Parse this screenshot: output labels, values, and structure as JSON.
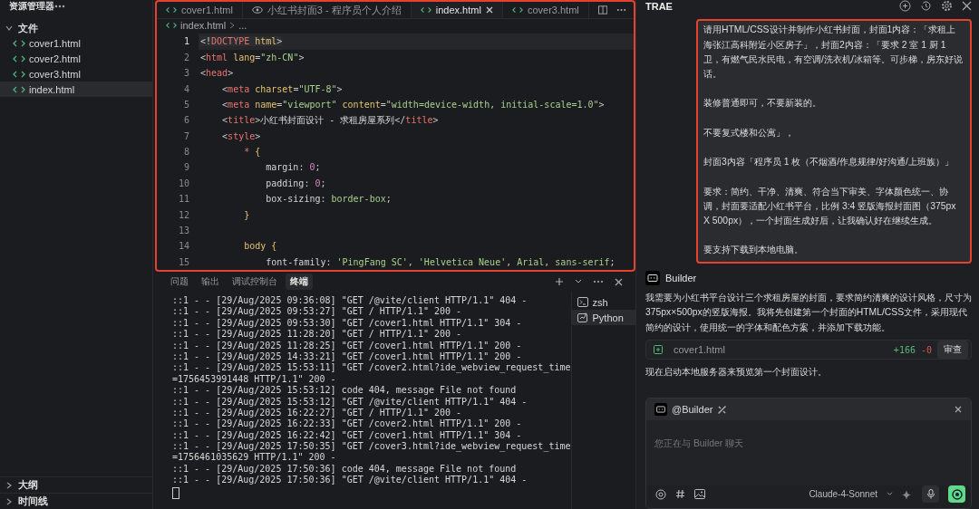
{
  "sidebar": {
    "title": "资源管理器",
    "folder": {
      "label": "文件",
      "expanded": true,
      "children": [
        {
          "label": "cover1.html",
          "selected": false
        },
        {
          "label": "cover2.html",
          "selected": false
        },
        {
          "label": "cover3.html",
          "selected": false
        },
        {
          "label": "index.html",
          "selected": true
        }
      ]
    },
    "sections": [
      {
        "label": "大纲",
        "expanded": false
      },
      {
        "label": "时间线",
        "expanded": false
      }
    ]
  },
  "editor": {
    "tabs": [
      {
        "label": "cover1.html",
        "kind": "code",
        "selected": false
      },
      {
        "label": "小红书封面3 - 程序员个人介绍",
        "kind": "preview",
        "selected": false
      },
      {
        "label": "index.html",
        "kind": "code",
        "selected": true
      },
      {
        "label": "cover3.html",
        "kind": "code",
        "selected": false
      }
    ],
    "breadcrumb": [
      "index.html",
      "..."
    ],
    "lines": [
      {
        "number": "1",
        "current": true,
        "tokens": [
          {
            "kind": "p",
            "text": "<!"
          },
          {
            "kind": "tag",
            "text": "DOCTYPE"
          },
          {
            "kind": "attr",
            "text": " html"
          },
          {
            "kind": "p",
            "text": ">"
          }
        ]
      },
      {
        "number": "2",
        "current": false,
        "tokens": [
          {
            "kind": "p",
            "text": "<"
          },
          {
            "kind": "tag",
            "text": "html"
          },
          {
            "kind": "attr",
            "text": " lang"
          },
          {
            "kind": "p",
            "text": "="
          },
          {
            "kind": "str",
            "text": "\"zh-CN\""
          },
          {
            "kind": "p",
            "text": ">"
          }
        ]
      },
      {
        "number": "3",
        "current": false,
        "tokens": [
          {
            "kind": "p",
            "text": "<"
          },
          {
            "kind": "tag",
            "text": "head"
          },
          {
            "kind": "p",
            "text": ">"
          }
        ]
      },
      {
        "number": "4",
        "current": false,
        "tokens": [
          {
            "kind": "p",
            "text": "    <"
          },
          {
            "kind": "tag",
            "text": "meta"
          },
          {
            "kind": "attr",
            "text": " charset"
          },
          {
            "kind": "p",
            "text": "="
          },
          {
            "kind": "str",
            "text": "\"UTF-8\""
          },
          {
            "kind": "p",
            "text": ">"
          }
        ]
      },
      {
        "number": "5",
        "current": false,
        "tokens": [
          {
            "kind": "p",
            "text": "    <"
          },
          {
            "kind": "tag",
            "text": "meta"
          },
          {
            "kind": "attr",
            "text": " name"
          },
          {
            "kind": "p",
            "text": "="
          },
          {
            "kind": "str",
            "text": "\"viewport\""
          },
          {
            "kind": "attr",
            "text": " content"
          },
          {
            "kind": "p",
            "text": "="
          },
          {
            "kind": "str",
            "text": "\"width=device-width, initial-scale=1.0\""
          },
          {
            "kind": "p",
            "text": ">"
          }
        ]
      },
      {
        "number": "6",
        "current": false,
        "tokens": [
          {
            "kind": "p",
            "text": "    <"
          },
          {
            "kind": "tag",
            "text": "title"
          },
          {
            "kind": "p",
            "text": ">"
          },
          {
            "kind": "txt",
            "text": "小红书封面设计 - 求租房屋系列"
          },
          {
            "kind": "p",
            "text": "</"
          },
          {
            "kind": "tag",
            "text": "title"
          },
          {
            "kind": "p",
            "text": ">"
          }
        ]
      },
      {
        "number": "7",
        "current": false,
        "tokens": [
          {
            "kind": "p",
            "text": "    <"
          },
          {
            "kind": "tag",
            "text": "style"
          },
          {
            "kind": "p",
            "text": ">"
          }
        ]
      },
      {
        "number": "8",
        "current": false,
        "tokens": [
          {
            "kind": "sel",
            "text": "        *"
          },
          {
            "kind": "brace",
            "text": " {"
          }
        ]
      },
      {
        "number": "9",
        "current": false,
        "tokens": [
          {
            "kind": "prop",
            "text": "            margin"
          },
          {
            "kind": "p",
            "text": ": "
          },
          {
            "kind": "num",
            "text": "0"
          },
          {
            "kind": "p",
            "text": ";"
          }
        ]
      },
      {
        "number": "10",
        "current": false,
        "tokens": [
          {
            "kind": "prop",
            "text": "            padding"
          },
          {
            "kind": "p",
            "text": ": "
          },
          {
            "kind": "num",
            "text": "0"
          },
          {
            "kind": "p",
            "text": ";"
          }
        ]
      },
      {
        "number": "11",
        "current": false,
        "tokens": [
          {
            "kind": "prop",
            "text": "            box-sizing"
          },
          {
            "kind": "p",
            "text": ": "
          },
          {
            "kind": "val",
            "text": "border-box"
          },
          {
            "kind": "p",
            "text": ";"
          }
        ]
      },
      {
        "number": "12",
        "current": false,
        "tokens": [
          {
            "kind": "brace",
            "text": "        }"
          }
        ]
      },
      {
        "number": "13",
        "current": false
      },
      {
        "number": "14",
        "current": false,
        "tokens": [
          {
            "kind": "brace",
            "text": "        body {"
          }
        ]
      },
      {
        "number": "15",
        "current": false,
        "tokens": [
          {
            "kind": "prop",
            "text": "            font-family"
          },
          {
            "kind": "p",
            "text": ": "
          },
          {
            "kind": "val",
            "text": "'PingFang SC', 'Helvetica Neue', Arial, sans-serif"
          },
          {
            "kind": "p",
            "text": ";"
          }
        ]
      }
    ]
  },
  "panel": {
    "tabs": [
      {
        "label": "问题",
        "selected": false
      },
      {
        "label": "输出",
        "selected": false
      },
      {
        "label": "调试控制台",
        "selected": false
      },
      {
        "label": "终端",
        "selected": true
      }
    ],
    "terminal": [
      "::1 - - [29/Aug/2025 09:36:08] \"GET /@vite/client HTTP/1.1\" 404 -",
      "::1 - - [29/Aug/2025 09:53:27] \"GET / HTTP/1.1\" 200 -",
      "::1 - - [29/Aug/2025 09:53:30] \"GET /cover1.html HTTP/1.1\" 304 -",
      "::1 - - [29/Aug/2025 11:28:20] \"GET / HTTP/1.1\" 200 -",
      "::1 - - [29/Aug/2025 11:28:25] \"GET /cover1.html HTTP/1.1\" 200 -",
      "::1 - - [29/Aug/2025 14:33:21] \"GET /cover1.html HTTP/1.1\" 200 -",
      "::1 - - [29/Aug/2025 15:53:11] \"GET /cover2.html?ide_webview_request_time",
      "=1756453991448 HTTP/1.1\" 200 -",
      "::1 - - [29/Aug/2025 15:53:12] code 404, message File not found",
      "::1 - - [29/Aug/2025 15:53:12] \"GET /@vite/client HTTP/1.1\" 404 -",
      "::1 - - [29/Aug/2025 16:22:27] \"GET / HTTP/1.1\" 200 -",
      "::1 - - [29/Aug/2025 16:22:33] \"GET /cover2.html HTTP/1.1\" 200 -",
      "::1 - - [29/Aug/2025 16:22:42] \"GET /cover1.html HTTP/1.1\" 304 -",
      "::1 - - [29/Aug/2025 17:50:35] \"GET /cover3.html?ide_webview_request_time",
      "=1756461035629 HTTP/1.1\" 200 -",
      "::1 - - [29/Aug/2025 17:50:36] code 404, message File not found",
      "::1 - - [29/Aug/2025 17:50:36] \"GET /@vite/client HTTP/1.1\" 404 -"
    ],
    "sessions": [
      {
        "label": "zsh",
        "kind": "shell",
        "selected": false
      },
      {
        "label": "Python",
        "kind": "python",
        "selected": true
      }
    ]
  },
  "chat": {
    "title": "TRAE",
    "user_message": [
      "请用HTML/CSS设计并制作小红书封面，封面1内容：「求租上海张江高科附近小区房子」，封面2内容：「要求 2 室 1 厨 1 卫，有燃气民水民电，有空调/洗衣机/冰箱等。可步梯，房东好说话。",
      "装修普通即可，不要新装的。",
      "不要复式楼和公寓」，",
      "封面3内容「程序员 1 枚（不烟酒/作息规律/好沟通/上班族）」",
      "要求：简约、干净、清爽、符合当下审美、字体颜色统一、协调，封面要适配小红书平台，比例 3:4 竖版海报封面图（375px X 500px），一个封面生成好后，让我确认好在继续生成。",
      "要支持下载到本地电脑。"
    ],
    "agent": "Builder",
    "reply": "我需要为小红书平台设计三个求租房屋的封面，要求简约清爽的设计风格，尺寸为375px×500px的竖版海报。我将先创建第一个封面的HTML/CSS文件，采用现代简约的设计，使用统一的字体和配色方案，并添加下载功能。",
    "file": {
      "name": "cover1.html",
      "added": "+166",
      "removed": "-0",
      "action": "审查"
    },
    "status": "现在启动本地服务器来预览第一个封面设计。",
    "input": {
      "mention": "@Builder",
      "placeholder": "您正在与 Builder 聊天",
      "model": "Claude-4-Sonnet"
    }
  }
}
